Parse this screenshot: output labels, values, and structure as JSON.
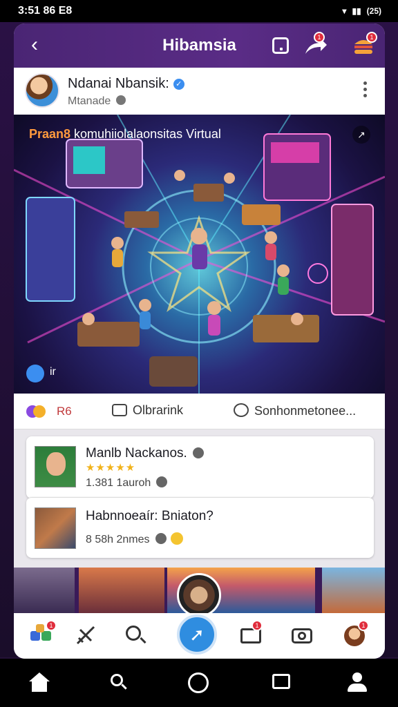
{
  "status_bar": {
    "time": "3:51 86 E8",
    "battery": "(25)"
  },
  "header": {
    "title": "Hibamsia",
    "share_badge": "1",
    "menu_badge": "1"
  },
  "post": {
    "author": "Ndanai Nbansik:",
    "subtitle": "Mtanade",
    "image_caption_highlight": "Praan8",
    "image_caption_rest": " komuhiiolalaonsitas Virtual",
    "overlay_label": "ir",
    "reaction_count": "R6",
    "comment_label": "Olbrarink",
    "share_label": "Sonhonmetonee..."
  },
  "feed": {
    "cards": [
      {
        "title": "Manlb Nackanos.",
        "stars": "★★★★★",
        "meta": "1.381 1auroh"
      },
      {
        "title": "Habnnoeaír: Bniaton?",
        "meta": "8 58h 2nmes"
      }
    ]
  },
  "tabs": {
    "home_badge": "1",
    "mail_badge": "1",
    "profile_badge": "1"
  },
  "colors": {
    "header": "#4a2574",
    "accent": "#2f8de0",
    "badge": "#e02d3c"
  },
  "icons": [
    "back-icon",
    "square-icon",
    "share-icon",
    "burger-icon",
    "verified-icon",
    "globe-icon",
    "more-icon",
    "expand-icon",
    "crown-icon",
    "comment-icon",
    "share-action-icon",
    "home-icon",
    "compass-icon",
    "search-icon",
    "edit-icon",
    "mail-icon",
    "camera-icon",
    "profile-icon"
  ]
}
